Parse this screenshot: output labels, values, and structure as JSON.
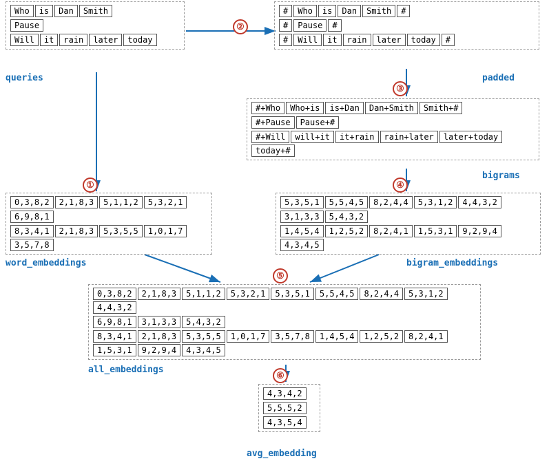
{
  "labels": {
    "queries": "queries",
    "padded": "padded",
    "bigrams": "bigrams",
    "word_embeddings": "word_embeddings",
    "bigram_embeddings": "bigram_embeddings",
    "all_embeddings": "all_embeddings",
    "avg_embedding": "avg_embedding"
  },
  "queries": {
    "row1": [
      "Who",
      "is",
      "Dan",
      "Smith"
    ],
    "row2": [
      "Pause"
    ],
    "row3": [
      "Will",
      "it",
      "rain",
      "later",
      "today"
    ]
  },
  "padded": {
    "row1": [
      "#",
      "Who",
      "is",
      "Dan",
      "Smith",
      "#"
    ],
    "row2": [
      "#",
      "Pause",
      "#"
    ],
    "row3": [
      "#",
      "Will",
      "it",
      "rain",
      "later",
      "today",
      "#"
    ]
  },
  "bigrams": {
    "row1": [
      "#+Who",
      "Who+is",
      "is+Dan",
      "Dan+Smith",
      "Smith+#"
    ],
    "row2": [
      "#+Pause",
      "Pause+#"
    ],
    "row3": [
      "#+Will",
      "will+it",
      "it+rain",
      "rain+later",
      "later+today",
      "today+#"
    ]
  },
  "word_embeddings": {
    "row1": [
      "0,3,8,2",
      "2,1,8,3",
      "5,1,1,2",
      "5,3,2,1"
    ],
    "row2": [
      "6,9,8,1"
    ],
    "row3": [
      "8,3,4,1",
      "2,1,8,3",
      "5,3,5,5",
      "1,0,1,7",
      "3,5,7,8"
    ]
  },
  "bigram_embeddings": {
    "row1": [
      "5,3,5,1",
      "5,5,4,5",
      "8,2,4,4",
      "5,3,1,2",
      "4,4,3,2"
    ],
    "row2": [
      "3,1,3,3",
      "5,4,3,2"
    ],
    "row3": [
      "1,4,5,4",
      "1,2,5,2",
      "8,2,4,1",
      "1,5,3,1",
      "9,2,9,4",
      "4,3,4,5"
    ]
  },
  "all_embeddings": {
    "row1": [
      "0,3,8,2",
      "2,1,8,3",
      "5,1,1,2",
      "5,3,2,1",
      "5,3,5,1",
      "5,5,4,5",
      "8,2,4,4",
      "5,3,1,2",
      "4,4,3,2"
    ],
    "row2": [
      "6,9,8,1",
      "3,1,3,3",
      "5,4,3,2"
    ],
    "row3": [
      "8,3,4,1",
      "2,1,8,3",
      "5,3,5,5",
      "1,0,1,7",
      "3,5,7,8",
      "1,4,5,4",
      "1,2,5,2",
      "8,2,4,1",
      "1,5,3,1",
      "9,2,9,4",
      "4,3,4,5"
    ]
  },
  "avg_embedding": {
    "row1": [
      "4,3,4,2"
    ],
    "row2": [
      "5,5,5,2"
    ],
    "row3": [
      "4,3,5,4"
    ]
  },
  "circle_numbers": [
    "①",
    "②",
    "③",
    "④",
    "⑤",
    "⑥"
  ]
}
